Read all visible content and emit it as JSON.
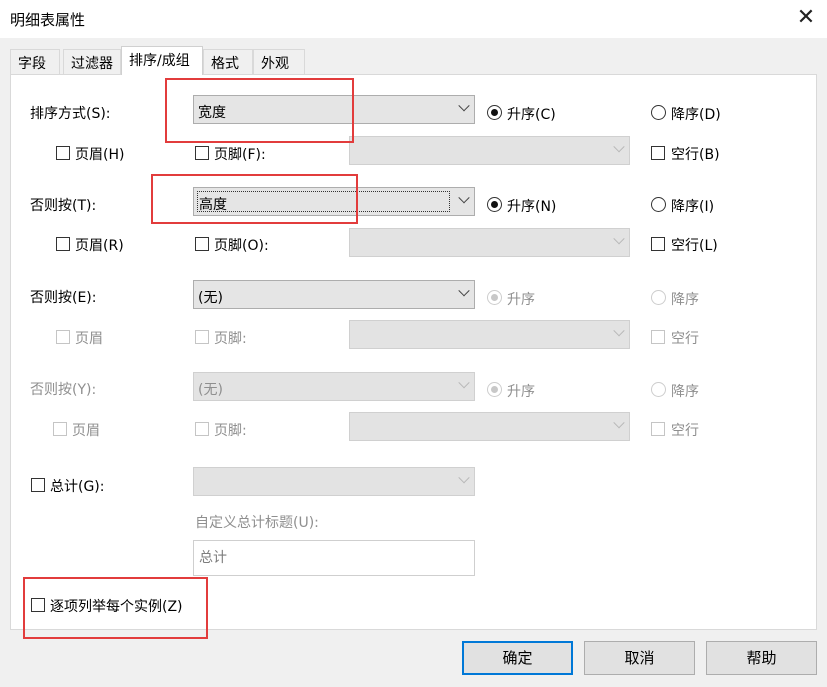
{
  "window": {
    "title": "明细表属性",
    "close_glyph": "✕"
  },
  "tabs": [
    {
      "label": "字段"
    },
    {
      "label": "过滤器"
    },
    {
      "label": "排序/成组"
    },
    {
      "label": "格式"
    },
    {
      "label": "外观"
    }
  ],
  "rows": [
    {
      "label": "排序方式(S):",
      "combo_value": "宽度",
      "asc": "升序(C)",
      "desc": "降序(D)",
      "header": "页眉(H)",
      "footer": "页脚(F):",
      "blank": "空行(B)"
    },
    {
      "label": "否则按(T):",
      "combo_value": "高度",
      "asc": "升序(N)",
      "desc": "降序(I)",
      "header": "页眉(R)",
      "footer": "页脚(O):",
      "blank": "空行(L)"
    },
    {
      "label": "否则按(E):",
      "combo_value": "(无)",
      "asc": "升序",
      "desc": "降序",
      "header": "页眉",
      "footer": "页脚:",
      "blank": "空行"
    },
    {
      "label": "否则按(Y):",
      "combo_value": "(无)",
      "asc": "升序",
      "desc": "降序",
      "header": "页眉",
      "footer": "页脚:",
      "blank": "空行"
    }
  ],
  "grand_total": {
    "label": "总计(G):",
    "custom_title_label": "自定义总计标题(U):",
    "custom_title_value": "总计"
  },
  "itemize": {
    "label": "逐项列举每个实例(Z)"
  },
  "buttons": {
    "ok": "确定",
    "cancel": "取消",
    "help": "帮助"
  },
  "colors": {
    "highlight_box": "#e23c3c",
    "focus_border": "#0078d7"
  }
}
